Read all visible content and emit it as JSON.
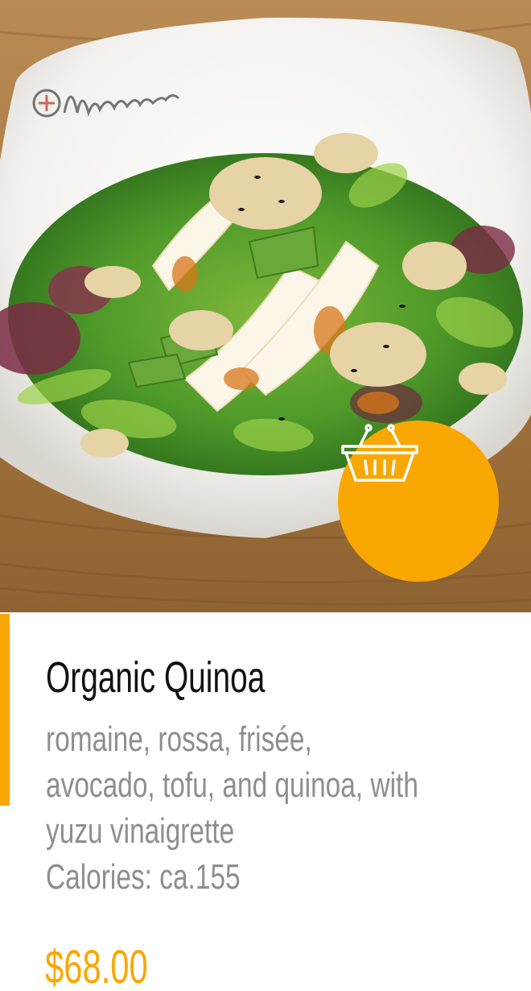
{
  "product": {
    "name": "Organic Quinoa",
    "description_lines": [
      "romaine, rossa, frisée,",
      "avocado, tofu, and quinoa, with",
      "yuzu vinaigrette"
    ],
    "calories": "Calories: ca.155",
    "price": "$68.00",
    "bowl_logo_text": "Habitu"
  },
  "cart_button": {
    "icon": "shopping-basket-icon"
  },
  "colors": {
    "accent": "#f9a702",
    "title": "#111111",
    "description": "#8e8e8e",
    "background": "#ffffff"
  }
}
